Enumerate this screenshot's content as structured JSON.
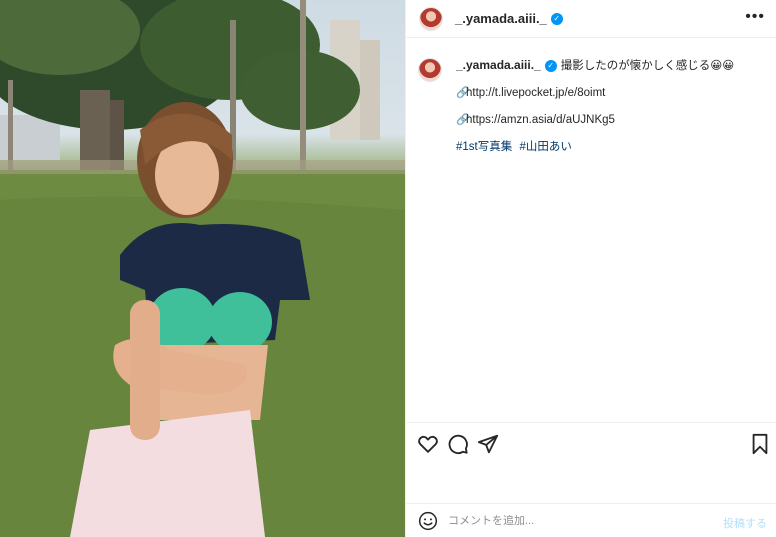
{
  "post": {
    "username": "_.yamada.aiii._",
    "verified_icon": "verified-badge-icon",
    "more_icon": "more-options-icon"
  },
  "caption": {
    "username": "_.yamada.aiii._",
    "text": "撮影したのが懐かしく感じる😀😀",
    "link1": "http://t.livepocket.jp/e/8oimt",
    "link2": "https://amzn.asia/d/aUJNKg5",
    "hashtags": [
      "#1st写真集",
      "#山田あい"
    ]
  },
  "actions": {
    "icons": [
      "heart-icon",
      "comment-icon",
      "share-icon",
      "bookmark-icon"
    ]
  },
  "comment": {
    "placeholder": "コメントを追加...",
    "post_label": "投稿する",
    "emoji_icon": "emoji-icon"
  },
  "colors": {
    "verified": "#0095f6",
    "hashtag": "#00376b",
    "post_button_disabled": "#b2dffc"
  }
}
